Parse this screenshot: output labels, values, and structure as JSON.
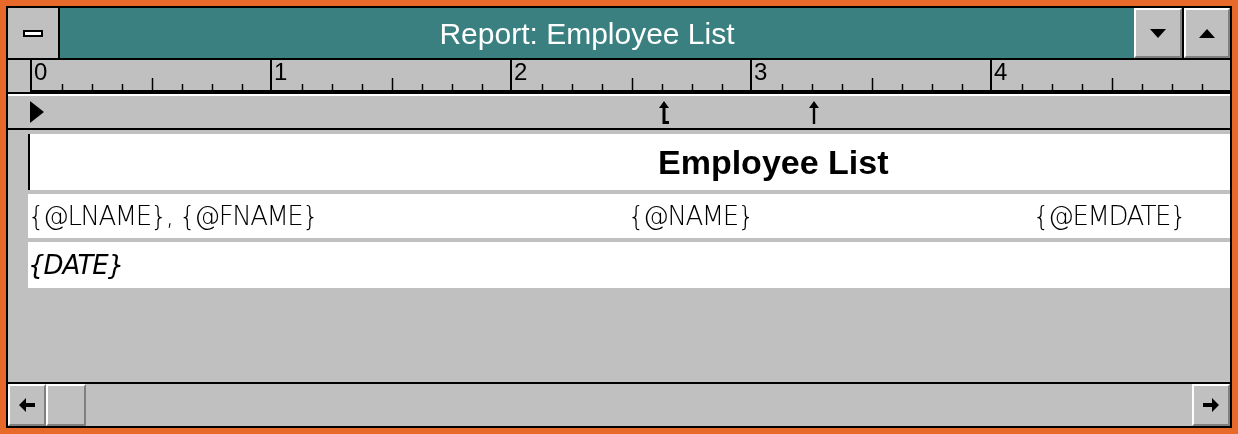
{
  "window": {
    "title": "Report: Employee List"
  },
  "ruler": {
    "labels": [
      "0",
      "1",
      "2",
      "3",
      "4"
    ],
    "tab_stops": [
      {
        "kind": "left"
      },
      {
        "kind": "center"
      }
    ]
  },
  "report": {
    "sections": [
      {
        "kind": "title",
        "fields": [
          {
            "text": "Employee List"
          }
        ]
      },
      {
        "kind": "detail",
        "fields": [
          {
            "text": "{@LNAME}, {@FNAME}"
          },
          {
            "text": "{@NAME}"
          },
          {
            "text": "{@EMDATE}"
          }
        ]
      },
      {
        "kind": "footer",
        "fields": [
          {
            "text": "{DATE}"
          }
        ]
      }
    ]
  }
}
